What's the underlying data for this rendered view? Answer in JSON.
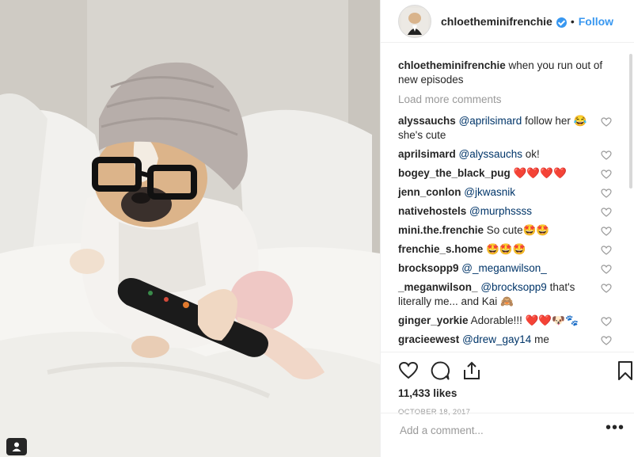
{
  "post": {
    "username": "chloetheminifrenchie",
    "follow_label": "Follow",
    "dot": "•",
    "caption_user": "chloetheminifrenchie",
    "caption_text": "when you run out of new episodes",
    "load_more": "Load more comments",
    "likes": "11,433 likes",
    "date": "OCTOBER 18, 2017",
    "add_comment_placeholder": "Add a comment...",
    "more_label": "•••"
  },
  "comments": [
    {
      "user": "alyssauchs",
      "mention": "@aprilsimard",
      "text": " follow her 😂 she's cute"
    },
    {
      "user": "aprilsimard",
      "mention": "@alyssauchs",
      "text": " ok!"
    },
    {
      "user": "bogey_the_black_pug",
      "mention": "",
      "text": " ❤️❤️❤️❤️"
    },
    {
      "user": "jenn_conlon",
      "mention": "@jkwasnik",
      "text": ""
    },
    {
      "user": "nativehostels",
      "mention": "@murphssss",
      "text": ""
    },
    {
      "user": "mini.the.frenchie",
      "mention": "",
      "text": " So cute🤩🤩"
    },
    {
      "user": "frenchie_s.home",
      "mention": "",
      "text": " 🤩🤩🤩"
    },
    {
      "user": "brocksopp9",
      "mention": "@_meganwilson_",
      "text": ""
    },
    {
      "user": "_meganwilson_",
      "mention": "@brocksopp9",
      "text": " that's literally me... and Kai 🙈"
    },
    {
      "user": "ginger_yorkie",
      "mention": "",
      "text": " Adorable!!! ❤️❤️🐶🐾"
    },
    {
      "user": "gracieewest",
      "mention": "@drew_gay14",
      "text": " me"
    }
  ],
  "colors": {
    "accent": "#3897f0",
    "text": "#262626",
    "muted": "#999999",
    "heart": "#ed4956"
  },
  "icons": [
    "heart-icon",
    "comment-icon",
    "share-icon",
    "bookmark-icon",
    "verified-icon",
    "user-tag-icon"
  ]
}
